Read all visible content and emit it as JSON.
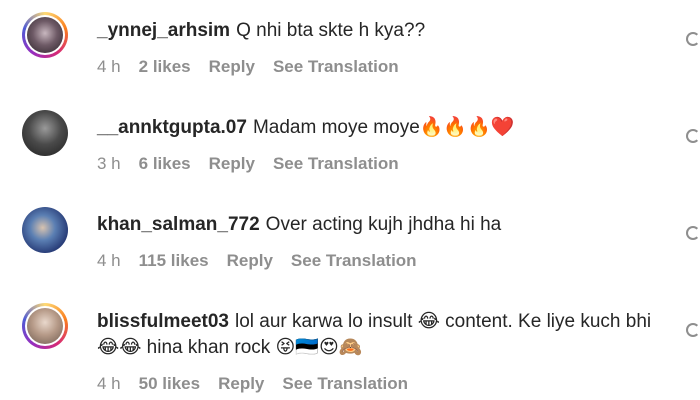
{
  "comments": [
    {
      "username": "_ynnej_arhsim",
      "text": "Q nhi bta skte h kya??",
      "time": "4 h",
      "likes": "2 likes",
      "reply": "Reply",
      "translate": "See Translation"
    },
    {
      "username": "__annktgupta.07",
      "text": "Madam moye moye🔥🔥🔥❤️",
      "time": "3 h",
      "likes": "6 likes",
      "reply": "Reply",
      "translate": "See Translation"
    },
    {
      "username": "khan_salman_772",
      "text": "Over acting kujh jhdha hi ha",
      "time": "4 h",
      "likes": "115 likes",
      "reply": "Reply",
      "translate": "See Translation"
    },
    {
      "username": "blissfulmeet03",
      "text": "lol aur karwa lo insult 😂 content. Ke liye kuch bhi 😂😂 hina khan rock 😝🇪🇪😍🙈",
      "time": "4 h",
      "likes": "50 likes",
      "reply": "Reply",
      "translate": "See Translation"
    }
  ],
  "icons": {
    "like": "heart-icon"
  }
}
